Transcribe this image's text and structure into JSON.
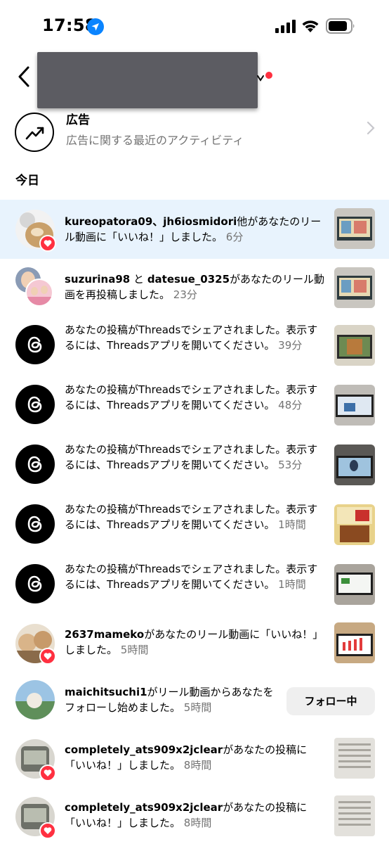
{
  "status_bar": {
    "time": "17:58",
    "location_icon": "location-arrow-icon",
    "signal_icon": "cellular-signal-icon",
    "wifi_icon": "wifi-icon",
    "battery_icon": "battery-icon"
  },
  "nav": {
    "back_icon": "back-chevron-icon",
    "account_dropdown_icon": "chevron-down-icon"
  },
  "ads": {
    "title": "広告",
    "subtitle": "広告に関する最近のアクティビティ",
    "icon": "trending-up-icon"
  },
  "sections": {
    "today": "今日"
  },
  "notifications": [
    {
      "user": "kureopatora09、jh6iosmidori",
      "text": "他があなたのリール動画に「いいね！」しました。",
      "time": "6分",
      "type": "like"
    },
    {
      "user": "suzurina98",
      "text": "と",
      "user2": "datesue_0325",
      "text2": "があなたのリール動画を再投稿しました。",
      "time": "23分",
      "type": "repost"
    },
    {
      "text": "あなたの投稿がThreadsでシェアされました。表示するには、Threadsアプリを開いてください。",
      "time": "39分",
      "type": "threads"
    },
    {
      "text": "あなたの投稿がThreadsでシェアされました。表示するには、Threadsアプリを開いてください。",
      "time": "48分",
      "type": "threads"
    },
    {
      "text": "あなたの投稿がThreadsでシェアされました。表示するには、Threadsアプリを開いてください。",
      "time": "53分",
      "type": "threads"
    },
    {
      "text": "あなたの投稿がThreadsでシェアされました。表示するには、Threadsアプリを開いてください。",
      "time": "1時間",
      "type": "threads"
    },
    {
      "text": "あなたの投稿がThreadsでシェアされました。表示するには、Threadsアプリを開いてください。",
      "time": "1時間",
      "type": "threads"
    },
    {
      "user": "2637mameko",
      "text": "があなたのリール動画に「いいね！」しました。",
      "time": "5時間",
      "type": "like"
    },
    {
      "user": "maichitsuchi1",
      "text": "がリール動画からあなたをフォローし始めました。",
      "time": "5時間",
      "type": "follow",
      "button": "フォロー中"
    },
    {
      "user": "completely_ats909x2jclear",
      "text": "があなたの投稿に「いいね！」しました。",
      "time": "8時間",
      "type": "like"
    },
    {
      "user": "completely_ats909x2jclear",
      "text": "があなたの投稿に「いいね！」しました。",
      "time": "8時間",
      "type": "like"
    }
  ],
  "colors": {
    "highlight": "#e8f3fd",
    "like_badge": "#ff3040",
    "secondary_text": "#737373",
    "follow_button_bg": "#efefef"
  }
}
